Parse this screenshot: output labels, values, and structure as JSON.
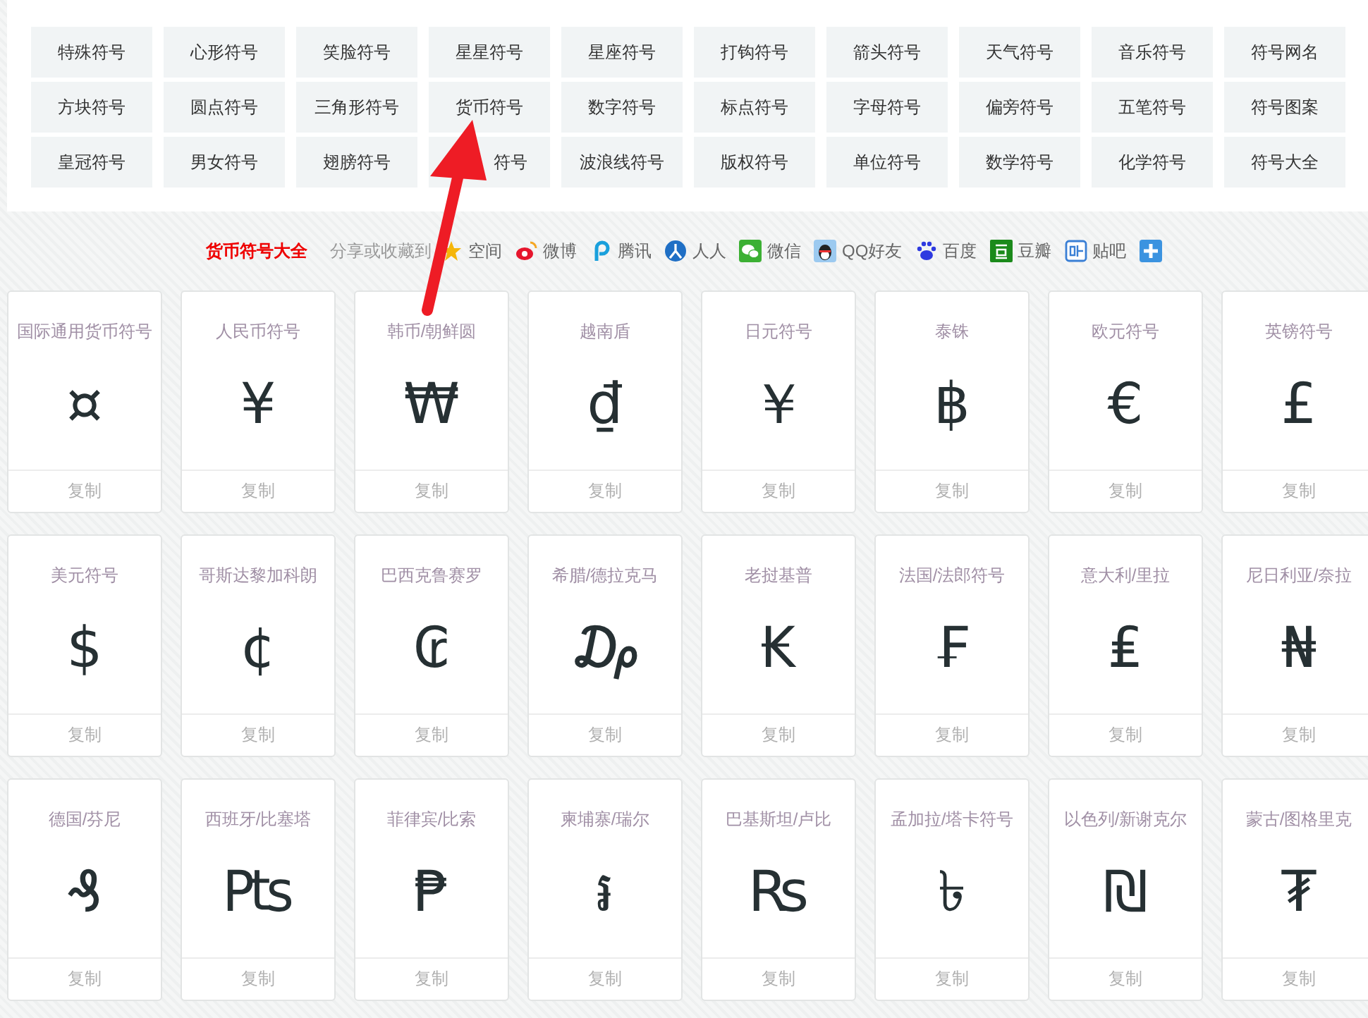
{
  "categories": [
    {
      "label": "特殊符号",
      "kind": "full"
    },
    {
      "label": "心形符号",
      "kind": "full"
    },
    {
      "label": "笑脸符号",
      "kind": "full"
    },
    {
      "label": "星星符号",
      "kind": "full"
    },
    {
      "label": "星座符号",
      "kind": "full"
    },
    {
      "label": "打钩符号",
      "kind": "full"
    },
    {
      "label": "箭头符号",
      "kind": "full"
    },
    {
      "label": "天气符号",
      "kind": "full"
    },
    {
      "label": "音乐符号",
      "kind": "full"
    },
    {
      "label": "符号网名",
      "kind": "full"
    },
    {
      "label": "方块符号",
      "kind": "full"
    },
    {
      "label": "圆点符号",
      "kind": "full"
    },
    {
      "label": "三角形符号",
      "kind": "full"
    },
    {
      "label": "货币符号",
      "kind": "full"
    },
    {
      "label": "数字符号",
      "kind": "full"
    },
    {
      "label": "标点符号",
      "kind": "full"
    },
    {
      "label": "字母符号",
      "kind": "full"
    },
    {
      "label": "偏旁符号",
      "kind": "full"
    },
    {
      "label": "五笔符号",
      "kind": "full"
    },
    {
      "label": "符号图案",
      "kind": "full"
    },
    {
      "label": "皇冠符号",
      "kind": "full"
    },
    {
      "label": "男女符号",
      "kind": "full"
    },
    {
      "label": "翅膀符号",
      "kind": "full"
    },
    {
      "label": "符号",
      "kind": "cut-left"
    },
    {
      "label": "波浪线符号",
      "kind": "full"
    },
    {
      "label": "版权符号",
      "kind": "full"
    },
    {
      "label": "单位符号",
      "kind": "full"
    },
    {
      "label": "数学符号",
      "kind": "full"
    },
    {
      "label": "化学符号",
      "kind": "full"
    },
    {
      "label": "符号大全",
      "kind": "full"
    }
  ],
  "share": {
    "title": "货币符号大全",
    "prompt": "分享或收藏到",
    "targets": [
      {
        "kind": "qzone",
        "label": "空间"
      },
      {
        "kind": "weibo",
        "label": "微博"
      },
      {
        "kind": "tencent",
        "label": "腾讯"
      },
      {
        "kind": "renren",
        "label": "人人"
      },
      {
        "kind": "wechat",
        "label": "微信"
      },
      {
        "kind": "qq",
        "label": "QQ好友"
      },
      {
        "kind": "baidu",
        "label": "百度"
      },
      {
        "kind": "douban",
        "label": "豆瓣"
      },
      {
        "kind": "tieba",
        "label": "贴吧"
      },
      {
        "kind": "more"
      }
    ]
  },
  "cards": [
    {
      "name": "国际通用货币符号",
      "symbol": "¤",
      "action": "复制"
    },
    {
      "name": "人民币符号",
      "symbol": "¥",
      "action": "复制"
    },
    {
      "name": "韩币/朝鲜圆",
      "symbol": "₩",
      "action": "复制"
    },
    {
      "name": "越南盾",
      "symbol": "₫",
      "action": "复制"
    },
    {
      "name": "日元符号",
      "symbol": "￥",
      "action": "复制"
    },
    {
      "name": "泰铢",
      "symbol": "฿",
      "action": "复制"
    },
    {
      "name": "欧元符号",
      "symbol": "€",
      "action": "复制"
    },
    {
      "name": "英镑符号",
      "symbol": "£",
      "action": "复制"
    },
    {
      "name": "美元符号",
      "symbol": "$",
      "action": "复制"
    },
    {
      "name": "哥斯达黎加科朗",
      "symbol": "¢",
      "action": "复制"
    },
    {
      "name": "巴西克鲁赛罗",
      "symbol": "₢",
      "action": "复制"
    },
    {
      "name": "希腊/德拉克马",
      "symbol": "₯",
      "action": "复制"
    },
    {
      "name": "老挝基普",
      "symbol": "₭",
      "action": "复制"
    },
    {
      "name": "法国/法郎符号",
      "symbol": "₣",
      "action": "复制"
    },
    {
      "name": "意大利/里拉",
      "symbol": "₤",
      "action": "复制"
    },
    {
      "name": "尼日利亚/奈拉",
      "symbol": "₦",
      "action": "复制"
    },
    {
      "name": "德国/芬尼",
      "symbol": "₰",
      "action": "复制"
    },
    {
      "name": "西班牙/比塞塔",
      "symbol": "₧",
      "action": "复制"
    },
    {
      "name": "菲律宾/比索",
      "symbol": "₱",
      "action": "复制"
    },
    {
      "name": "柬埔寨/瑞尔",
      "symbol": "៛",
      "action": "复制"
    },
    {
      "name": "巴基斯坦/卢比",
      "symbol": "₨",
      "action": "复制"
    },
    {
      "name": "孟加拉/塔卡符号",
      "symbol": "৳",
      "action": "复制"
    },
    {
      "name": "以色列/新谢克尔",
      "symbol": "₪",
      "action": "复制"
    },
    {
      "name": "蒙古/图格里克",
      "symbol": "₮",
      "action": "复制"
    }
  ]
}
